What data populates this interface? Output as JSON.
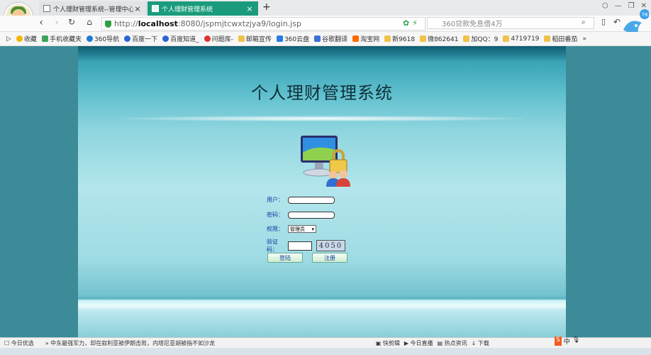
{
  "browser": {
    "tabs": [
      {
        "title": "个人理财管理系统--管理中心",
        "active": false
      },
      {
        "title": "个人理财管理系统",
        "active": true
      }
    ],
    "new_tab": "+",
    "url_scheme": "http://",
    "url_host": "localhost",
    "url_rest": ":8080/jspmjtcwxtzjya9/login.jsp",
    "search_placeholder": "360贷款免息借4万",
    "badge": "78",
    "bookmarks": [
      "收藏",
      "手机收藏夹",
      "360导航",
      "百度一下",
      "百度知道_",
      "问题库-",
      "邮箱宣传",
      "360云盘",
      "谷歌翻译",
      "淘宝网",
      "新9618",
      "微862641",
      "加QQ：9",
      "4719719",
      "稻田番茄",
      "»"
    ]
  },
  "login": {
    "title": "个人理财管理系统",
    "username_label": "用户：",
    "password_label": "密码：",
    "role_label": "权限：",
    "role_value": "管理员",
    "captcha_label": "验证码：",
    "captcha_code": "4050",
    "login_button": "登陆",
    "register_button": "注册"
  },
  "statusbar": {
    "today": "今日优选",
    "news": "中东最强军力，却在叙利亚被伊朗击败，内塔尼亚胡被指不如沙龙",
    "items": [
      "快剪辑",
      "今日直播",
      "热点资讯",
      "下载"
    ],
    "sogou": "中"
  },
  "colors": {
    "accent": "#1a9c7c",
    "page_bg": "#3d8b98",
    "label_blue": "#0b3b9e"
  }
}
